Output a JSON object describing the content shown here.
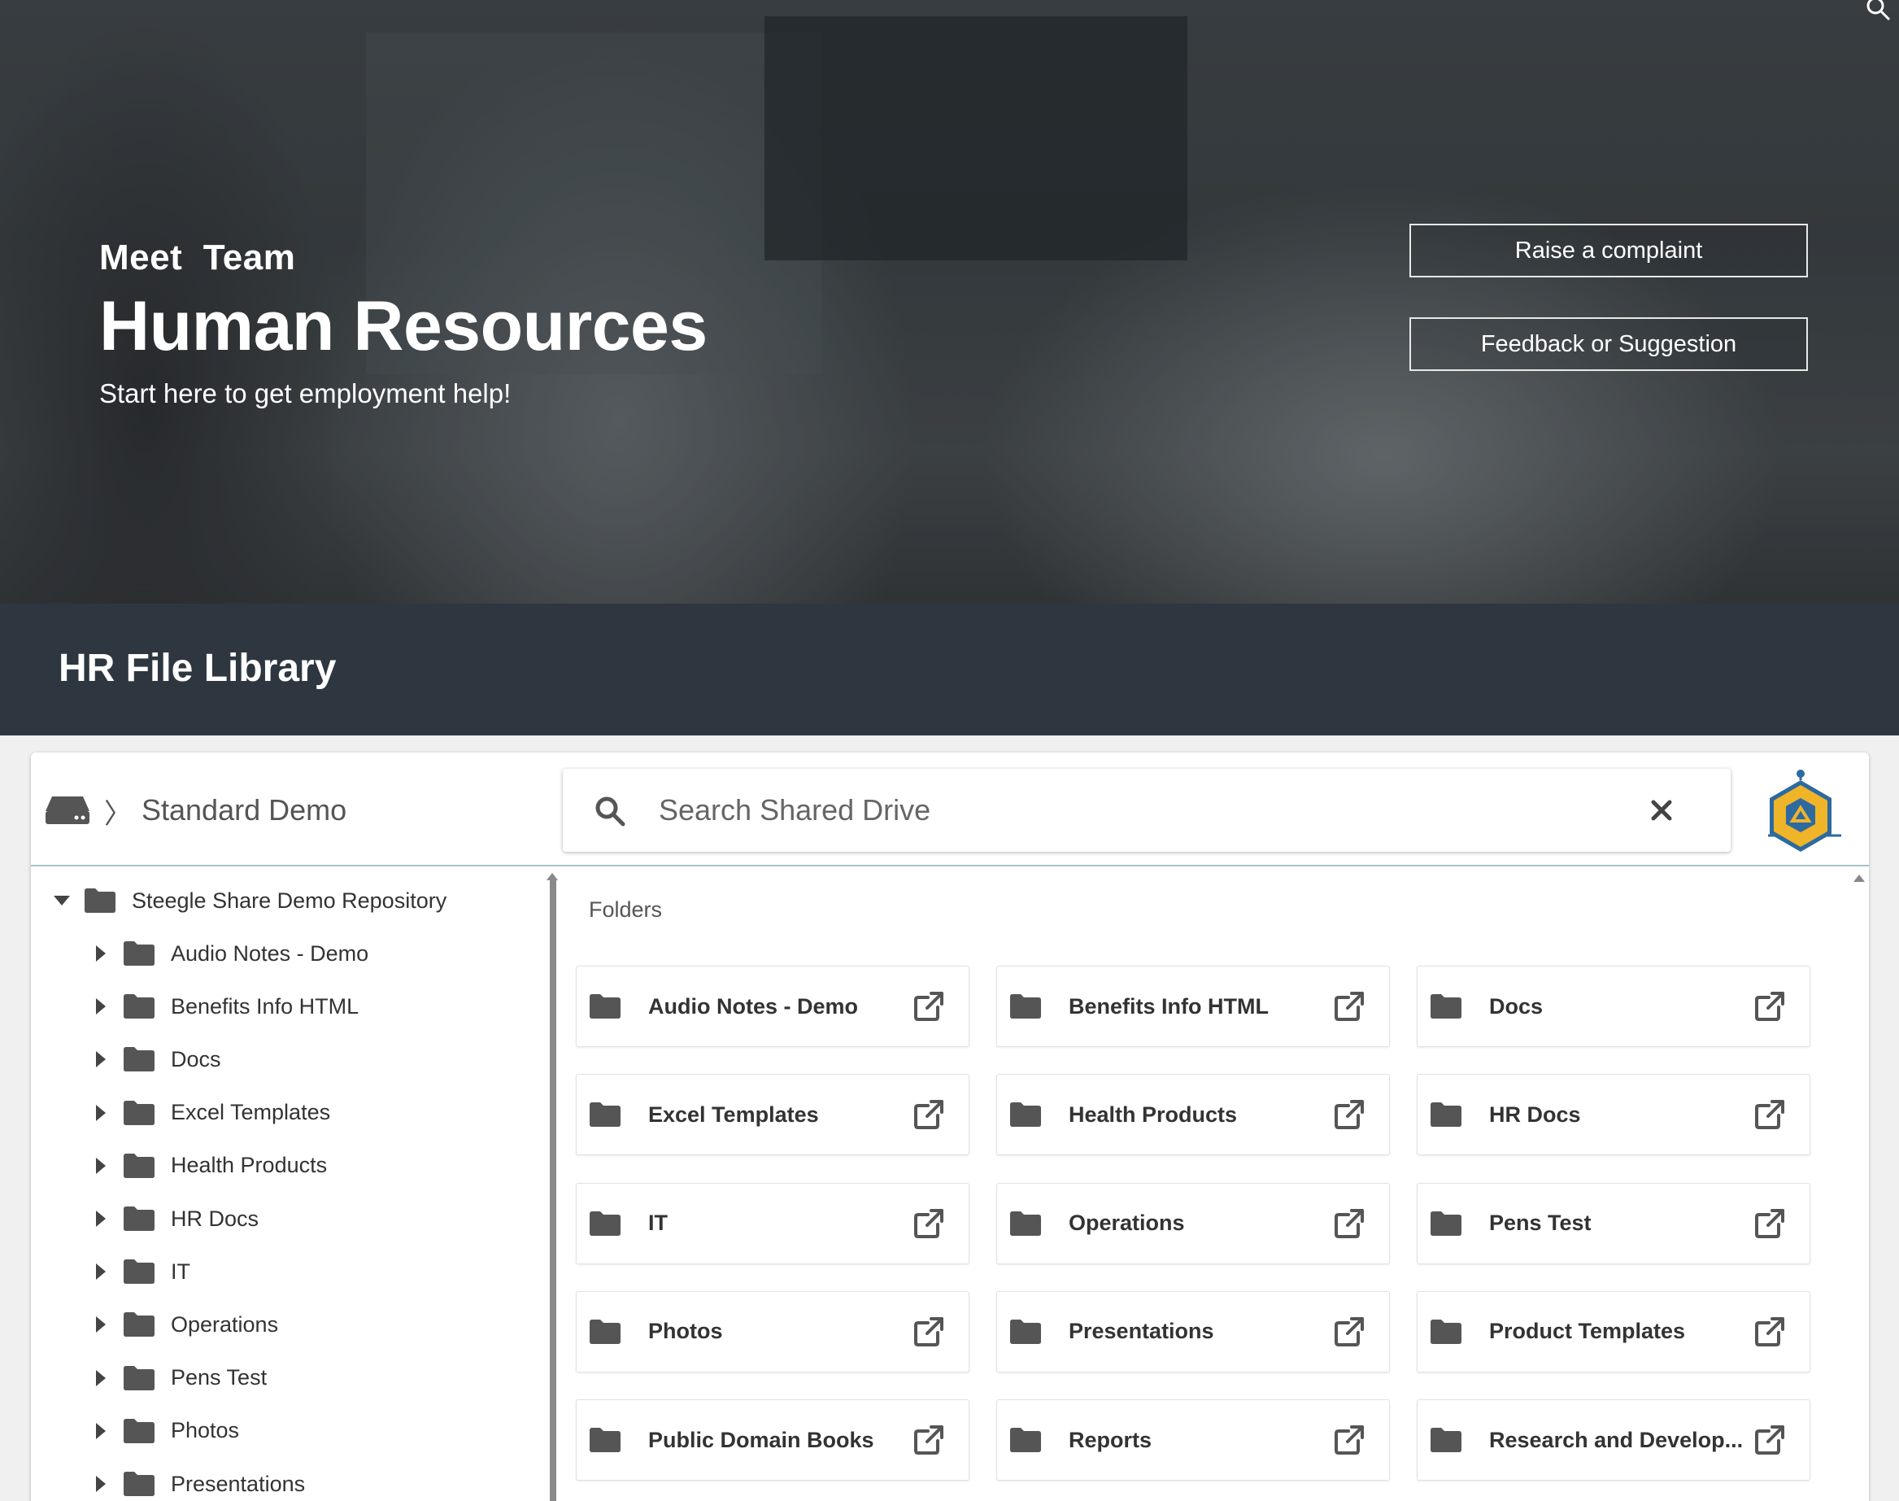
{
  "hero": {
    "subtitle": "Meet  Team",
    "title": "Human Resources",
    "tagline": "Start here to get employment help!",
    "buttons": {
      "complaint": "Raise a complaint",
      "feedback": "Feedback or Suggestion"
    }
  },
  "library": {
    "title": "HR File Library"
  },
  "browser": {
    "breadcrumb": "Standard Demo",
    "search": {
      "placeholder": "Search Shared Drive",
      "value": ""
    },
    "tree": {
      "root": "Steegle Share Demo Repository",
      "items": [
        "Audio Notes - Demo",
        "Benefits Info HTML",
        "Docs",
        "Excel Templates",
        "Health Products",
        "HR Docs",
        "IT",
        "Operations",
        "Pens Test",
        "Photos",
        "Presentations"
      ]
    },
    "folders_label": "Folders",
    "folders": [
      "Audio Notes - Demo",
      "Benefits Info HTML",
      "Docs",
      "Excel Templates",
      "Health Products",
      "HR Docs",
      "IT",
      "Operations",
      "Pens Test",
      "Photos",
      "Presentations",
      "Product Templates",
      "Public Domain Books",
      "Reports",
      "Research and Develop..."
    ]
  },
  "colors": {
    "band": "#2e3740",
    "icon": "#555555",
    "logo_hex": "#f0b429",
    "logo_inner": "#2d6aa0"
  },
  "icons": [
    "search-icon",
    "drive-icon",
    "chevron-right-icon",
    "close-icon",
    "folder-icon",
    "caret-right-icon",
    "caret-down-icon",
    "open-external-icon",
    "steegle-logo"
  ]
}
